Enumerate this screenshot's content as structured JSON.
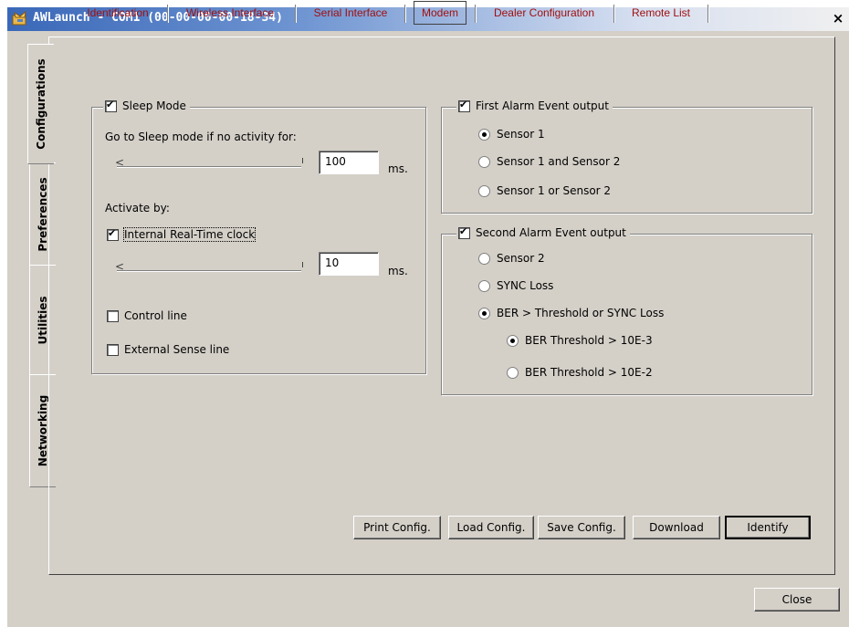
{
  "window": {
    "title": "AWLaunch - COM1  (00-00-00-00-18-34)",
    "close_glyph": "×"
  },
  "side_tabs": [
    {
      "label": "Configurations"
    },
    {
      "label": "Preferences"
    },
    {
      "label": "Utilities"
    },
    {
      "label": "Networking"
    }
  ],
  "top_tabs": [
    {
      "label": "Identification"
    },
    {
      "label": "Wireless Interface"
    },
    {
      "label": "Serial Interface"
    },
    {
      "label": "Modem"
    },
    {
      "label": "Dealer Configuration"
    },
    {
      "label": "Remote List"
    }
  ],
  "sleep": {
    "legend": "Sleep Mode",
    "legend_checked": true,
    "inactivity_label": "Go to Sleep mode if no activity for:",
    "inactivity_value": "100",
    "inactivity_unit": "ms.",
    "activate_label": "Activate by:",
    "rtc_label": "Internal Real-Time clock",
    "rtc_checked": true,
    "rtc_value": "10",
    "rtc_unit": "ms.",
    "control_line_label": "Control line",
    "control_line_checked": false,
    "external_sense_label": "External Sense line",
    "external_sense_checked": false
  },
  "first_alarm": {
    "legend": "First Alarm Event output",
    "checked": true,
    "options": [
      {
        "label": "Sensor 1",
        "selected": true
      },
      {
        "label": "Sensor 1 and Sensor 2",
        "selected": false
      },
      {
        "label": "Sensor 1 or Sensor 2",
        "selected": false
      }
    ]
  },
  "second_alarm": {
    "legend": "Second Alarm Event output",
    "checked": true,
    "options": [
      {
        "label": "Sensor 2",
        "selected": false
      },
      {
        "label": "SYNC Loss",
        "selected": false
      },
      {
        "label": "BER  > Threshold or SYNC Loss",
        "selected": true
      }
    ],
    "sub_options": [
      {
        "label": "BER Threshold > 10E-3",
        "selected": true
      },
      {
        "label": "BER Threshold > 10E-2",
        "selected": false
      }
    ]
  },
  "buttons": {
    "print": "Print Config.",
    "load": "Load Config.",
    "save": "Save Config.",
    "download": "Download",
    "identify": "Identify",
    "close": "Close"
  }
}
